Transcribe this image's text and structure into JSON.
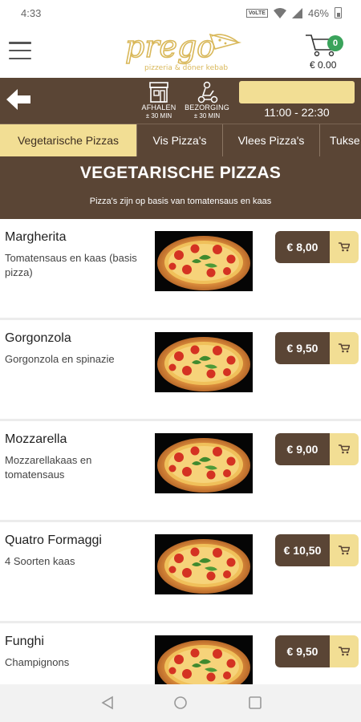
{
  "status": {
    "time": "4:33",
    "volte": "VoLTE",
    "battery": "46%"
  },
  "header": {
    "cart_count": "0",
    "cart_total": "€ 0.00"
  },
  "info": {
    "pickup_label": "AFHALEN",
    "pickup_time": "± 30 MIN",
    "delivery_label": "BEZORGING",
    "delivery_time": "± 30 MIN",
    "hours": "11:00 - 22:30"
  },
  "tabs": [
    {
      "label": "Vegetarische Pizzas"
    },
    {
      "label": "Vis Pizza's"
    },
    {
      "label": "Vlees Pizza's"
    },
    {
      "label": "Tukse"
    }
  ],
  "category": {
    "title": "VEGETARISCHE PIZZAS",
    "subtitle": "Pizza's zijn op basis van tomatensaus en kaas"
  },
  "items": [
    {
      "name": "Margherita",
      "desc": "Tomatensaus en kaas (basis pizza)",
      "price": "€ 8,00"
    },
    {
      "name": "Gorgonzola",
      "desc": "Gorgonzola en spinazie",
      "price": "€ 9,50"
    },
    {
      "name": "Mozzarella",
      "desc": "Mozzarellakaas en tomatensaus",
      "price": "€ 9,00"
    },
    {
      "name": "Quatro Formaggi",
      "desc": "4 Soorten kaas",
      "price": "€ 10,50"
    },
    {
      "name": "Funghi",
      "desc": "Champignons",
      "price": "€ 9,50"
    }
  ],
  "colors": {
    "brown": "#5a4535",
    "gold": "#f2de94",
    "badge_green": "#3aa35b"
  }
}
